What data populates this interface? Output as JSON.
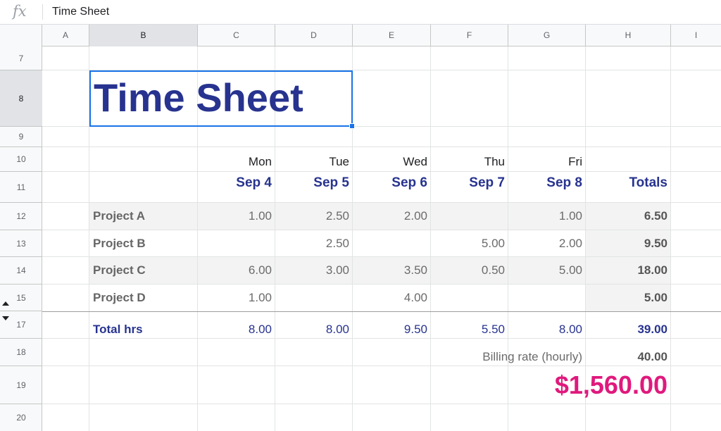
{
  "formula_bar": {
    "icon": "fx-icon",
    "content": "Time Sheet"
  },
  "columns": [
    "A",
    "B",
    "C",
    "D",
    "E",
    "F",
    "G",
    "H",
    "I"
  ],
  "rows": [
    "7",
    "8",
    "9",
    "10",
    "11",
    "12",
    "13",
    "14",
    "15",
    "17",
    "18",
    "19",
    "20"
  ],
  "sheet": {
    "title": "Time Sheet",
    "days": [
      "Mon",
      "Tue",
      "Wed",
      "Thu",
      "Fri"
    ],
    "dates": [
      "Sep 4",
      "Sep 5",
      "Sep 6",
      "Sep 7",
      "Sep 8"
    ],
    "totals_header": "Totals",
    "projects": [
      {
        "name": "Project A",
        "values": [
          "1.00",
          "2.50",
          "2.00",
          "",
          "1.00"
        ],
        "total": "6.50"
      },
      {
        "name": "Project B",
        "values": [
          "",
          "2.50",
          "",
          "5.00",
          "2.00"
        ],
        "total": "9.50"
      },
      {
        "name": "Project C",
        "values": [
          "6.00",
          "3.00",
          "3.50",
          "0.50",
          "5.00"
        ],
        "total": "18.00"
      },
      {
        "name": "Project D",
        "values": [
          "1.00",
          "",
          "4.00",
          "",
          ""
        ],
        "total": "5.00"
      }
    ],
    "total_hrs": {
      "label": "Total hrs",
      "values": [
        "8.00",
        "8.00",
        "9.50",
        "5.50",
        "8.00"
      ],
      "total": "39.00"
    },
    "billing_rate": {
      "label": "Billing rate (hourly)",
      "value": "40.00"
    },
    "amount": "$1,560.00"
  },
  "colors": {
    "title": "#27338f",
    "amount": "#e0197d",
    "selection": "#1a73e8"
  }
}
